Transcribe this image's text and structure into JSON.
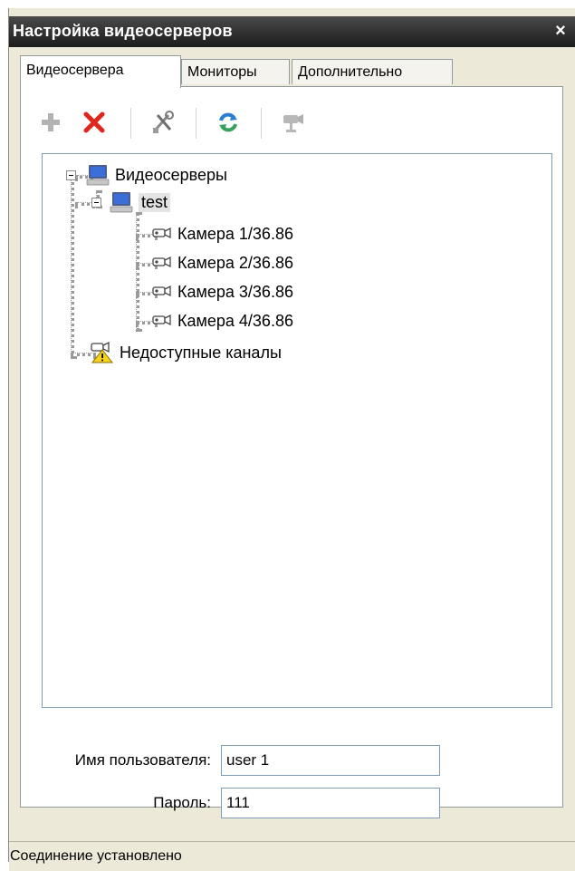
{
  "window": {
    "title": "Настройка видеосерверов",
    "close_glyph": "×"
  },
  "tabs": [
    {
      "label": "Видеосервера",
      "active": true
    },
    {
      "label": "Мониторы",
      "active": false
    },
    {
      "label": "Дополнительно",
      "active": false
    }
  ],
  "toolbar": {
    "buttons": [
      {
        "icon": "plus-icon",
        "enabled": false
      },
      {
        "icon": "delete-icon",
        "enabled": true
      },
      {
        "icon": "tools-icon",
        "enabled": true
      },
      {
        "icon": "refresh-icon",
        "enabled": true
      },
      {
        "icon": "camera-settings-icon",
        "enabled": false
      }
    ]
  },
  "tree": {
    "root": {
      "label": "Видеосерверы",
      "icon": "computer-icon",
      "expanded": true
    },
    "server": {
      "label": "test",
      "icon": "computer-icon",
      "expanded": true,
      "selected": true
    },
    "cameras": [
      {
        "label": "Камера 1/36.86",
        "icon": "camera-icon"
      },
      {
        "label": "Камера 2/36.86",
        "icon": "camera-icon"
      },
      {
        "label": "Камера 3/36.86",
        "icon": "camera-icon"
      },
      {
        "label": "Камера 4/36.86",
        "icon": "camera-icon"
      }
    ],
    "unavailable": {
      "label": "Недоступные каналы",
      "icon": "camera-warning-icon"
    }
  },
  "form": {
    "username_label": "Имя пользователя:",
    "username_value": "user 1",
    "password_label": "Пароль:",
    "password_value": "111"
  },
  "status": {
    "text": "Соединение установлено"
  },
  "colors": {
    "titlebar": "#2b2b2b",
    "delete_red": "#e0261c",
    "refresh_blue": "#2a7fd0",
    "window_bg": "#ece9d8"
  }
}
